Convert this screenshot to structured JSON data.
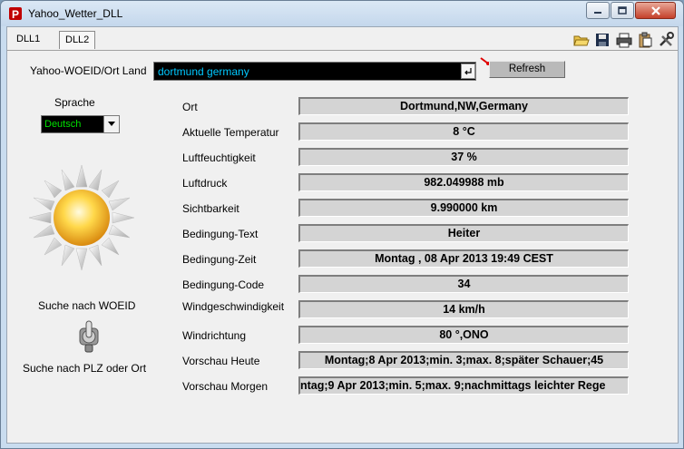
{
  "window": {
    "title": "Yahoo_Wetter_DLL",
    "icon": "red-p-app-icon",
    "buttons": [
      "minimize-icon",
      "maximize-icon",
      "close-icon"
    ]
  },
  "tabs": [
    {
      "label": "DLL1",
      "active": false
    },
    {
      "label": "DLL2",
      "active": true
    }
  ],
  "toolbar": {
    "icons": [
      "open-folder-icon",
      "save-icon",
      "print-icon",
      "clipboard-icon",
      "tools-icon"
    ]
  },
  "search": {
    "label": "Yahoo-WOEID/Ort Land",
    "value": "dortmund germany",
    "refresh_label": "Refresh"
  },
  "language": {
    "label": "Sprache",
    "selected": "Deutsch"
  },
  "switch": {
    "top_label": "Suche nach WOEID",
    "bottom_label": "Suche nach PLZ oder Ort"
  },
  "weather": [
    {
      "label": "Ort",
      "value": "Dortmund,NW,Germany"
    },
    {
      "label": "Aktuelle Temperatur",
      "value": "8 °C"
    },
    {
      "label": "Luftfeuchtigkeit",
      "value": "37 %"
    },
    {
      "label": "Luftdruck",
      "value": "982.049988 mb"
    },
    {
      "label": "Sichtbarkeit",
      "value": "9.990000 km"
    },
    {
      "label": "Bedingung-Text",
      "value": "Heiter"
    },
    {
      "label": "Bedingung-Zeit",
      "value": "Montag , 08 Apr 2013 19:49 CEST"
    },
    {
      "label": "Bedingung-Code",
      "value": "34"
    },
    {
      "label": "Windgeschwindigkeit",
      "value": "14 km/h"
    },
    {
      "label": "Windrichtung",
      "value": "80 °,ONO"
    },
    {
      "label": "Vorschau Heute",
      "value": "Montag;8 Apr 2013;min. 3;max. 8;später Schauer;45"
    },
    {
      "label": "Vorschau Morgen",
      "value": "ntag;9 Apr 2013;min. 5;max. 9;nachmittags leichter Rege"
    }
  ],
  "colors": {
    "input_bg": "#000000",
    "input_text": "#00c8ff",
    "select_text": "#00e000",
    "field_bg": "#d4d4d4"
  }
}
